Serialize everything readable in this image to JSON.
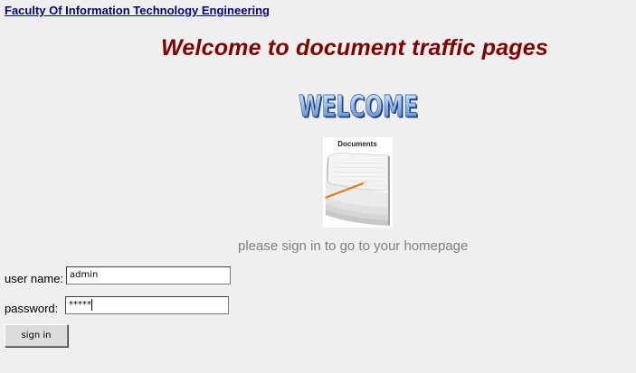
{
  "header": {
    "faculty_link": "Faculty Of Information Technology Engineering"
  },
  "main": {
    "title": "Welcome to document traffic pages",
    "welcome_banner_text": "WELCOME",
    "documents_image_label": "Documents",
    "signin_prompt": "please sign in to go to your homepage"
  },
  "form": {
    "username_label": "user name:",
    "username_value": "admin",
    "password_label": "password:",
    "password_value": "*****",
    "signin_button": "sign in"
  },
  "colors": {
    "background": "#efefef",
    "link": "#000080",
    "title": "#800000",
    "prompt": "#808080"
  }
}
